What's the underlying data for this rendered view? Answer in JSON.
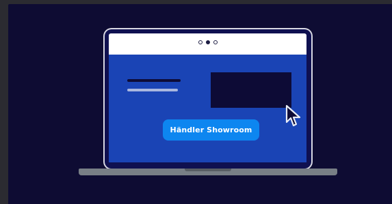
{
  "scene": {
    "button_label": "Händler Showroom",
    "browser_dots": 3,
    "active_dot_index": 1,
    "icons": {
      "cursor": "cursor-arrow-icon"
    },
    "colors": {
      "page_background": "#0e0c33",
      "frame_background": "#2b2b31",
      "screen_background": "#1a44b5",
      "button_background": "#0d86f0",
      "laptop_base": "#787f86"
    }
  }
}
